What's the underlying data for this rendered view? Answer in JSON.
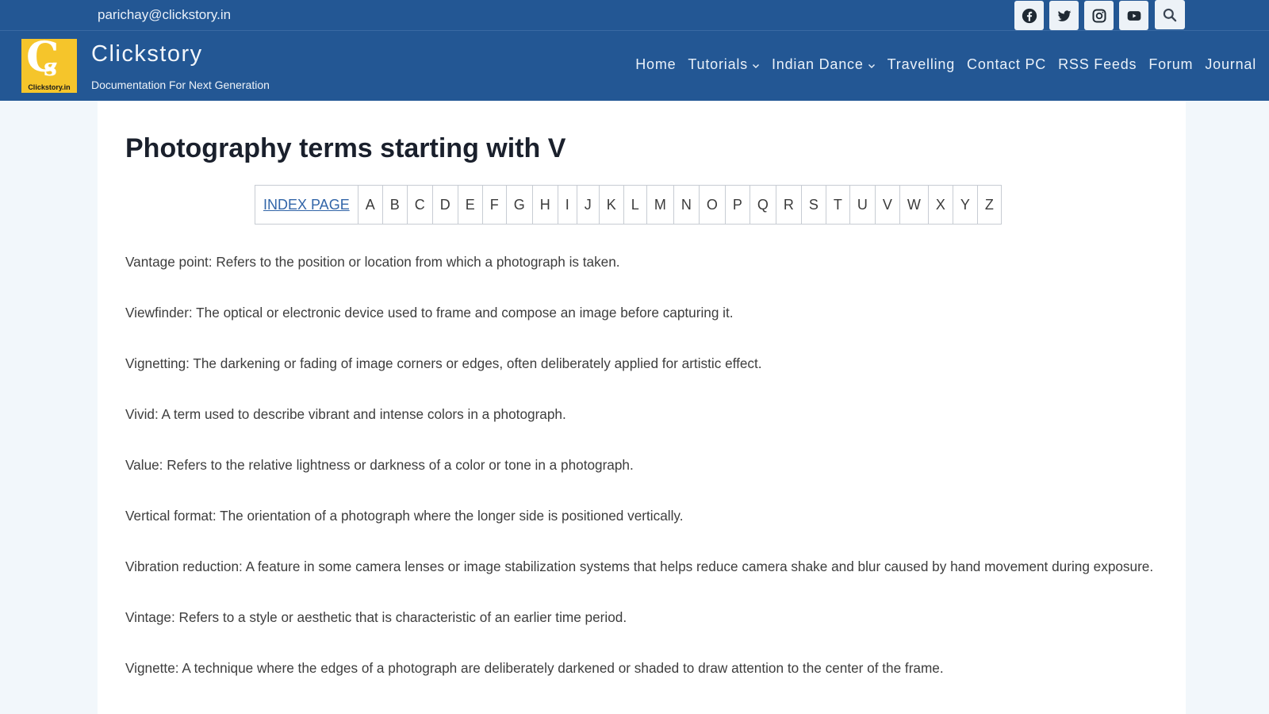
{
  "topbar": {
    "email": "parichay@clickstory.in",
    "social": [
      {
        "name": "facebook-icon",
        "label": "Facebook"
      },
      {
        "name": "twitter-icon",
        "label": "Twitter"
      },
      {
        "name": "instagram-icon",
        "label": "Instagram"
      },
      {
        "name": "youtube-icon",
        "label": "YouTube"
      }
    ],
    "search_icon": "search-icon"
  },
  "header": {
    "logo_letters": "C",
    "logo_letter_s": "s",
    "logo_caption": "Clickstory.in",
    "site_title": "Clickstory",
    "tagline": "Documentation For Next Generation",
    "nav": [
      {
        "label": "Home",
        "dropdown": false
      },
      {
        "label": "Tutorials",
        "dropdown": true
      },
      {
        "label": "Indian Dance",
        "dropdown": true
      },
      {
        "label": "Travelling",
        "dropdown": false
      },
      {
        "label": "Contact PC",
        "dropdown": false
      },
      {
        "label": "RSS Feeds",
        "dropdown": false
      },
      {
        "label": "Forum",
        "dropdown": false
      },
      {
        "label": "Journal",
        "dropdown": false
      }
    ]
  },
  "main": {
    "title": "Photography terms starting with V",
    "index_link": "INDEX PAGE",
    "letters": [
      "A",
      "B",
      "C",
      "D",
      "E",
      "F",
      "G",
      "H",
      "I",
      "J",
      "K",
      "L",
      "M",
      "N",
      "O",
      "P",
      "Q",
      "R",
      "S",
      "T",
      "U",
      "V",
      "W",
      "X",
      "Y",
      "Z"
    ],
    "terms": [
      "Vantage point: Refers to the position or location from which a photograph is taken.",
      "Viewfinder: The optical or electronic device used to frame and compose an image before capturing it.",
      "Vignetting: The darkening or fading of image corners or edges, often deliberately applied for artistic effect.",
      "Vivid: A term used to describe vibrant and intense colors in a photograph.",
      "Value: Refers to the relative lightness or darkness of a color or tone in a photograph.",
      "Vertical format: The orientation of a photograph where the longer side is positioned vertically.",
      "Vibration reduction: A feature in some camera lenses or image stabilization systems that helps reduce camera shake and blur caused by hand movement during exposure.",
      "Vintage: Refers to a style or aesthetic that is characteristic of an earlier time period.",
      "Vignette: A technique where the edges of a photograph are deliberately darkened or shaded to draw attention to the center of the frame."
    ]
  },
  "colors": {
    "brand_blue": "#235794",
    "logo_yellow": "#f5c52b",
    "link_blue": "#3265a8"
  }
}
